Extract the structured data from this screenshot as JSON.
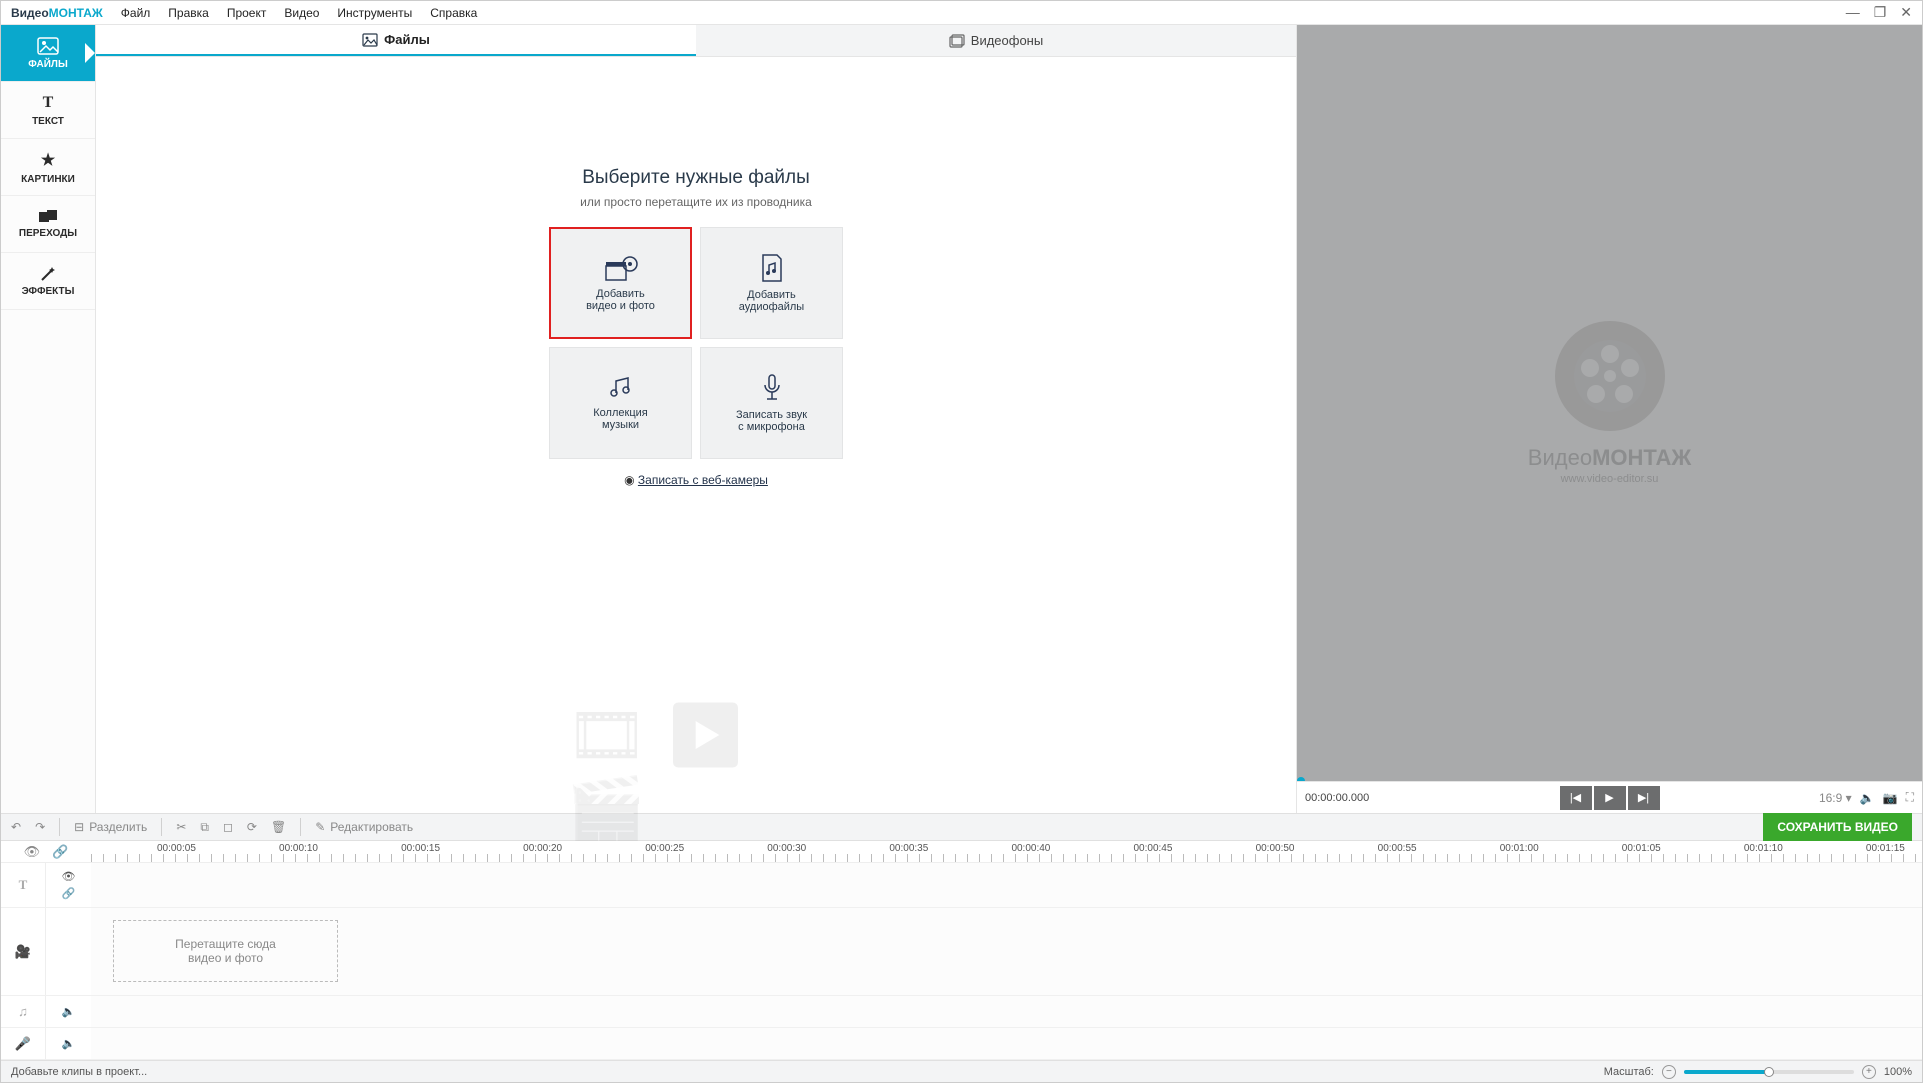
{
  "app": {
    "logo1": "Видео",
    "logo2": "МОНТАЖ"
  },
  "menu": [
    "Файл",
    "Правка",
    "Проект",
    "Видео",
    "Инструменты",
    "Справка"
  ],
  "leftnav": [
    {
      "label": "ФАЙЛЫ",
      "icon": "🖼"
    },
    {
      "label": "ТЕКСТ",
      "icon": "T"
    },
    {
      "label": "КАРТИНКИ",
      "icon": "★"
    },
    {
      "label": "ПЕРЕХОДЫ",
      "icon": "⧉"
    },
    {
      "label": "ЭФФЕКТЫ",
      "icon": "✦"
    }
  ],
  "tabs": {
    "files": "Файлы",
    "backgrounds": "Видеофоны"
  },
  "center": {
    "title": "Выберите нужные файлы",
    "subtitle": "или просто перетащите их из проводника",
    "sources": {
      "video": {
        "l1": "Добавить",
        "l2": "видео и фото"
      },
      "audio": {
        "l1": "Добавить",
        "l2": "аудиофайлы"
      },
      "music": {
        "l1": "Коллекция",
        "l2": "музыки"
      },
      "mic": {
        "l1": "Записать звук",
        "l2": "с микрофона"
      }
    },
    "webcam": "Записать с веб-камеры"
  },
  "preview": {
    "brand1": "Видео",
    "brand2": "МОНТАЖ",
    "url": "www.video-editor.su",
    "timecode": "00:00:00.000",
    "aspect": "16:9"
  },
  "toolbar": {
    "split": "Разделить",
    "edit": "Редактировать",
    "save": "СОХРАНИТЬ ВИДЕО"
  },
  "ruler_ticks": [
    "00:00:05",
    "00:00:10",
    "00:00:15",
    "00:00:20",
    "00:00:25",
    "00:00:30",
    "00:00:35",
    "00:00:40",
    "00:00:45",
    "00:00:50",
    "00:00:55",
    "00:01:00",
    "00:01:05",
    "00:01:10",
    "00:01:15"
  ],
  "dropzone": {
    "l1": "Перетащите сюда",
    "l2": "видео и фото"
  },
  "status": {
    "hint": "Добавьте клипы в проект...",
    "zoom_label": "Масштаб:",
    "zoom_pct": "100%"
  }
}
